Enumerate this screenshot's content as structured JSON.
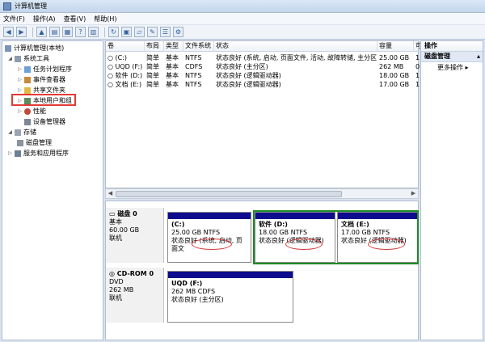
{
  "window": {
    "title": "计算机管理"
  },
  "menu": [
    "文件(F)",
    "操作(A)",
    "查看(V)",
    "帮助(H)"
  ],
  "tree": {
    "root": "计算机管理(本地)",
    "system_tools": "系统工具",
    "task_scheduler": "任务计划程序",
    "event_viewer": "事件查看器",
    "shared_folders": "共享文件夹",
    "local_users": "本地用户和组",
    "performance": "性能",
    "device_manager": "设备管理器",
    "storage": "存储",
    "disk_management": "磁盘管理",
    "services_apps": "服务和应用程序"
  },
  "volume_list": {
    "columns": [
      "卷",
      "布局",
      "类型",
      "文件系统",
      "状态",
      "容量",
      "可"
    ],
    "rows": [
      {
        "volume": "(C:)",
        "layout": "简单",
        "type": "基本",
        "fs": "NTFS",
        "status": "状态良好 (系统, 启动, 页面文件, 活动, 故障转储, 主分区)",
        "capacity": "25.00 GB",
        "free": "1"
      },
      {
        "volume": "UQD (F:)",
        "layout": "简单",
        "type": "基本",
        "fs": "CDFS",
        "status": "状态良好 (主分区)",
        "capacity": "262 MB",
        "free": "0"
      },
      {
        "volume": "软件 (D:)",
        "layout": "简单",
        "type": "基本",
        "fs": "NTFS",
        "status": "状态良好 (逻辑驱动器)",
        "capacity": "18.00 GB",
        "free": "1"
      },
      {
        "volume": "文档 (E:)",
        "layout": "简单",
        "type": "基本",
        "fs": "NTFS",
        "status": "状态良好 (逻辑驱动器)",
        "capacity": "17.00 GB",
        "free": "1"
      }
    ]
  },
  "disk0": {
    "name": "磁盘 0",
    "kind": "基本",
    "size": "60.00 GB",
    "state": "联机",
    "partitions": [
      {
        "name": "(C:)",
        "size": "25.00 GB NTFS",
        "status_prefix": "状态良好",
        "status_detail": "(系统, 启动, 页面文"
      },
      {
        "name": "软件  (D:)",
        "size": "18.00 GB NTFS",
        "status_prefix": "状态良好",
        "status_detail": "(逻辑驱动器)"
      },
      {
        "name": "文档  (E:)",
        "size": "17.00 GB NTFS",
        "status_prefix": "状态良好",
        "status_detail": "(逻辑驱动器)"
      }
    ]
  },
  "cdrom0": {
    "name": "CD-ROM 0",
    "kind": "DVD",
    "size": "262 MB",
    "state": "联机",
    "partition": {
      "name": "UQD  (F:)",
      "size": "262 MB CDFS",
      "status": "状态良好 (主分区)"
    }
  },
  "actions": {
    "header": "操作",
    "section": "磁盘管理",
    "more": "更多操作"
  },
  "colors": {
    "primary_bar": "#0d0b8e",
    "selection_green": "#1a8d24",
    "annotation_red": "#e23b35"
  }
}
